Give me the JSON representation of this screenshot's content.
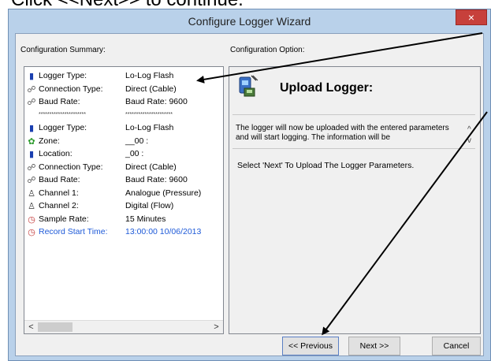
{
  "caption": "Click <<Next>> to continue.",
  "window": {
    "title": "Configure Logger Wizard",
    "close_glyph": "×"
  },
  "summary": {
    "label": "Configuration Summary:",
    "rows": [
      {
        "icon": "battery-icon",
        "glyph": "▮",
        "color": "#1a3fb0",
        "label": "Logger Type:",
        "value": "Lo-Log Flash"
      },
      {
        "icon": "cable-icon",
        "glyph": "☍",
        "color": "#555555",
        "label": "Connection Type:",
        "value": "Direct (Cable)"
      },
      {
        "icon": "cable-icon",
        "glyph": "☍",
        "color": "#555555",
        "label": "Baud Rate:",
        "value": "Baud Rate: 9600"
      },
      {
        "icon": "",
        "glyph": "",
        "color": "#000000",
        "label": "**********************",
        "value": "**********************"
      },
      {
        "icon": "battery-icon",
        "glyph": "▮",
        "color": "#1a3fb0",
        "label": "Logger Type:",
        "value": "Lo-Log Flash"
      },
      {
        "icon": "zone-icon",
        "glyph": "✿",
        "color": "#2a9a2a",
        "label": "Zone:",
        "value": "__00 :"
      },
      {
        "icon": "battery-icon",
        "glyph": "▮",
        "color": "#1a3fb0",
        "label": "Location:",
        "value": "_00 :"
      },
      {
        "icon": "cable-icon",
        "glyph": "☍",
        "color": "#555555",
        "label": "Connection Type:",
        "value": "Direct (Cable)"
      },
      {
        "icon": "cable-icon",
        "glyph": "☍",
        "color": "#555555",
        "label": "Baud Rate:",
        "value": "Baud Rate: 9600"
      },
      {
        "icon": "channel-icon",
        "glyph": "♙",
        "color": "#333333",
        "label": "Channel 1:",
        "value": "Analogue (Pressure)"
      },
      {
        "icon": "channel-icon",
        "glyph": "♙",
        "color": "#333333",
        "label": "Channel 2:",
        "value": "Digital (Flow)"
      },
      {
        "icon": "clock-icon",
        "glyph": "◷",
        "color": "#c03030",
        "label": "Sample Rate:",
        "value": "15 Minutes"
      },
      {
        "icon": "clock-icon",
        "glyph": "◷",
        "color": "#c03030",
        "label": "Record Start Time:",
        "value": "13:00:00 10/06/2013"
      }
    ],
    "scroll_left": "<",
    "scroll_right": ">"
  },
  "option": {
    "label": "Configuration Option:",
    "title": "Upload Logger:",
    "description": "The logger will now be uploaded with the entered parameters and will start logging. The information will be",
    "scroll_up": "^",
    "scroll_down": "v",
    "instruction": "Select 'Next' To Upload The Logger Parameters."
  },
  "buttons": {
    "previous": "<< Previous",
    "next": "Next >>",
    "cancel": "Cancel"
  },
  "colors": {
    "window_frame": "#b9d1ea",
    "close_button": "#c7403b",
    "link_blue": "#1e5ad8",
    "dialog_bg": "#f0f0f0"
  }
}
